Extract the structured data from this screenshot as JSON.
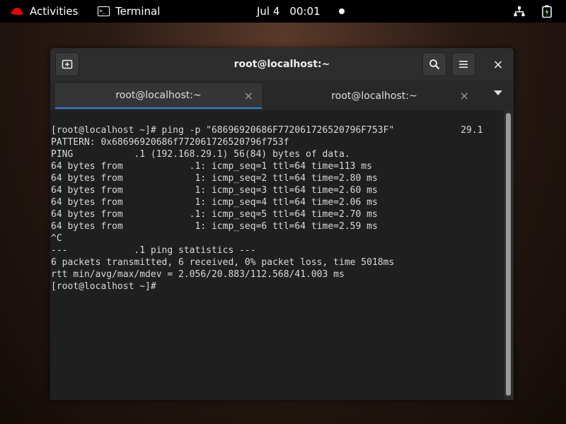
{
  "topbar": {
    "activities_label": "Activities",
    "app_name": "Terminal",
    "date": "Jul 4",
    "time": "00:01",
    "icons": [
      "redhat-logo-icon",
      "terminal-icon",
      "notification-dot-icon",
      "network-icon",
      "battery-icon"
    ]
  },
  "window": {
    "title": "root@localhost:~",
    "close_glyph": "×",
    "tabs": [
      {
        "label": "root@localhost:~",
        "close": "×",
        "active": true
      },
      {
        "label": "root@localhost:~",
        "close": "×",
        "active": false
      }
    ]
  },
  "terminal": {
    "lines": [
      "[root@localhost ~]# ping -p \"68696920686F772061726520796F753F\"            29.1",
      "PATTERN: 0x68696920686f772061726520796f753f",
      "PING           .1 (192.168.29.1) 56(84) bytes of data.",
      "64 bytes from            .1: icmp_seq=1 ttl=64 time=113 ms",
      "64 bytes from             1: icmp_seq=2 ttl=64 time=2.80 ms",
      "64 bytes from             1: icmp_seq=3 ttl=64 time=2.60 ms",
      "64 bytes from             1: icmp_seq=4 ttl=64 time=2.06 ms",
      "64 bytes from            .1: icmp_seq=5 ttl=64 time=2.70 ms",
      "64 bytes from             1: icmp_seq=6 ttl=64 time=2.59 ms",
      "^C",
      "---            .1 ping statistics ---",
      "6 packets transmitted, 6 received, 0% packet loss, time 5018ms",
      "rtt min/avg/max/mdev = 2.056/20.883/112.568/41.003 ms",
      "[root@localhost ~]#"
    ]
  },
  "colors": {
    "accent": "#3584e4",
    "terminal_bg": "#1f1f1f",
    "terminal_fg": "#d9d9d9"
  }
}
